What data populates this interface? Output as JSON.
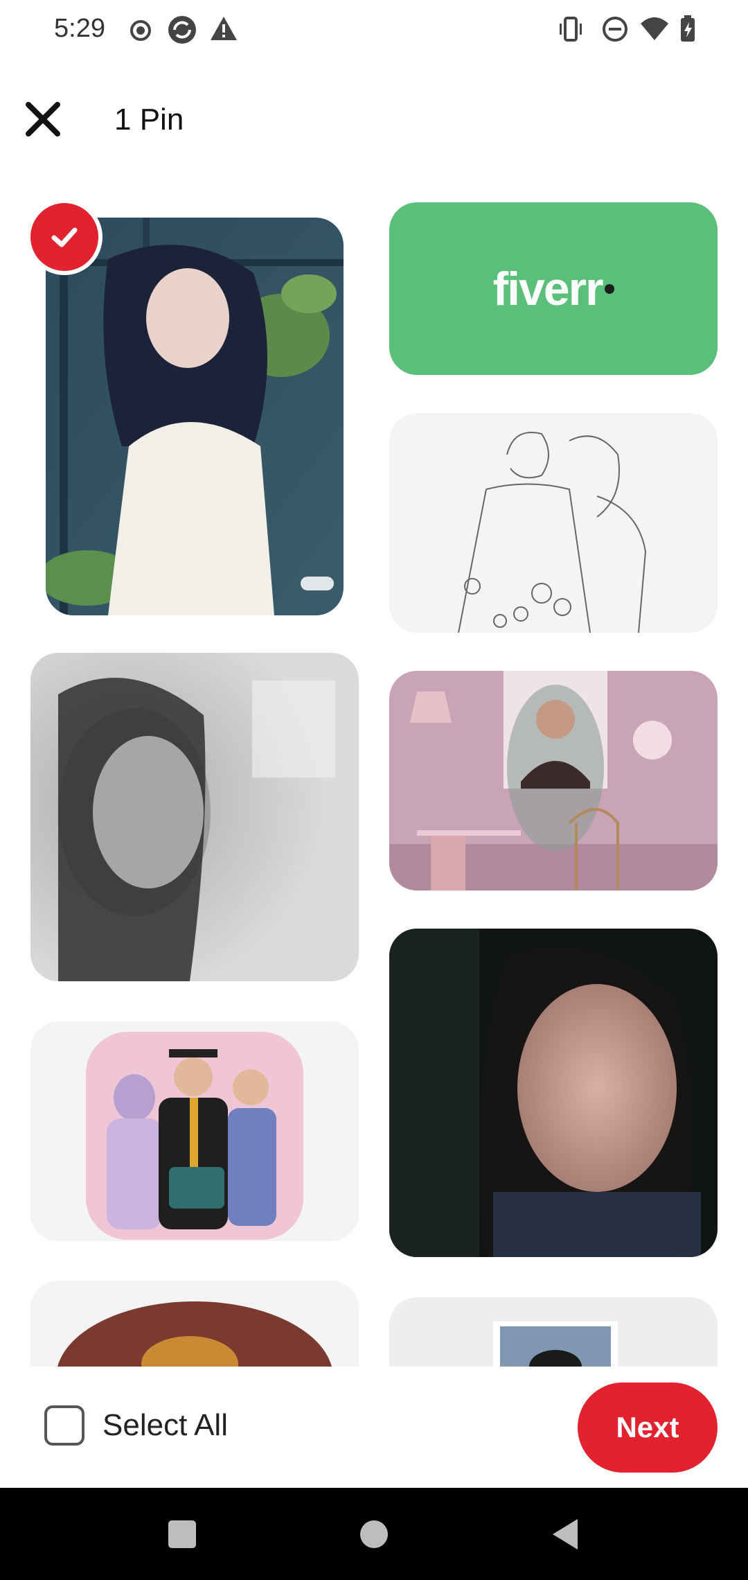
{
  "status_bar": {
    "time": "5:29",
    "left_icons": [
      "record-icon",
      "sync-icon",
      "warning-icon"
    ],
    "right_icons": [
      "vibrate-icon",
      "do-not-disturb-icon",
      "wifi-icon",
      "battery-charging-icon"
    ]
  },
  "header": {
    "close_icon": "close-icon",
    "title": "1 Pin"
  },
  "pins": [
    {
      "id": "anime-girl",
      "selected": true,
      "watermark": "小红书"
    },
    {
      "id": "fiverr-ad",
      "selected": false,
      "logo_text": "fiverr"
    },
    {
      "id": "couple-sketch",
      "selected": false
    },
    {
      "id": "blurred-bw-portrait",
      "selected": false
    },
    {
      "id": "pink-room-portrait",
      "selected": false
    },
    {
      "id": "graduation-family-cartoon",
      "selected": false
    },
    {
      "id": "blurred-woman-portrait",
      "selected": false
    },
    {
      "id": "partial-round-image",
      "selected": false
    },
    {
      "id": "partial-framed-image",
      "selected": false
    }
  ],
  "bottom_bar": {
    "select_all_label": "Select All",
    "select_all_checked": false,
    "next_label": "Next"
  },
  "colors": {
    "accent": "#e2222e",
    "fiverr_green": "#5abf78"
  },
  "nav_bar": {
    "buttons": [
      "recents-square-icon",
      "home-circle-icon",
      "back-triangle-icon"
    ]
  }
}
